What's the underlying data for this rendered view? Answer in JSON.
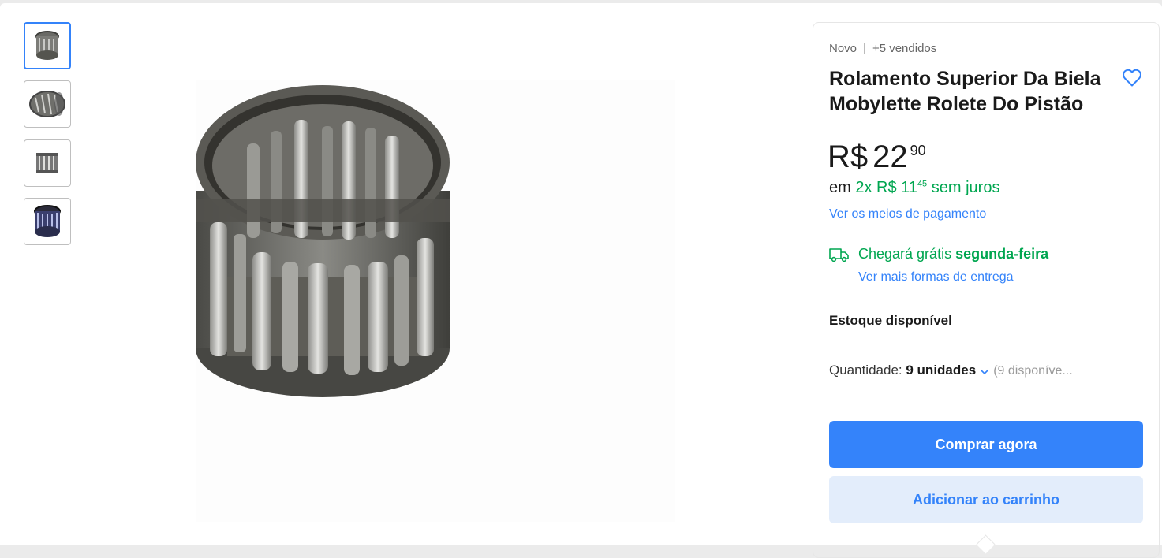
{
  "product": {
    "condition": "Novo",
    "sold": "+5 vendidos",
    "title": "Rolamento Superior Da Biela Mobylette Rolete Do Pistão",
    "price": {
      "currency": "R$",
      "integer": "22",
      "cents": "90"
    },
    "installments": {
      "prefix": "em",
      "count": "2x R$ 11",
      "cents": "45",
      "suffix": "sem juros"
    },
    "payment_link": "Ver os meios de pagamento",
    "shipping": {
      "text": "Chegará grátis",
      "day": "segunda-feira",
      "link": "Ver mais formas de entrega"
    },
    "stock": "Estoque disponível",
    "quantity": {
      "label": "Quantidade:",
      "value": "9 unidades",
      "available": "(9 disponíve..."
    },
    "buy_label": "Comprar agora",
    "cart_label": "Adicionar ao carrinho"
  },
  "gallery": {
    "thumbnails": [
      "bearing-top-view",
      "bearing-side-view",
      "bearing-front-view",
      "bearing-blue-view"
    ],
    "active_index": 0
  },
  "colors": {
    "accent": "#3483fa",
    "green": "#00a650"
  },
  "icons": {
    "favorite": "heart-icon",
    "shipping": "truck-icon",
    "dropdown": "chevron-down-icon"
  }
}
